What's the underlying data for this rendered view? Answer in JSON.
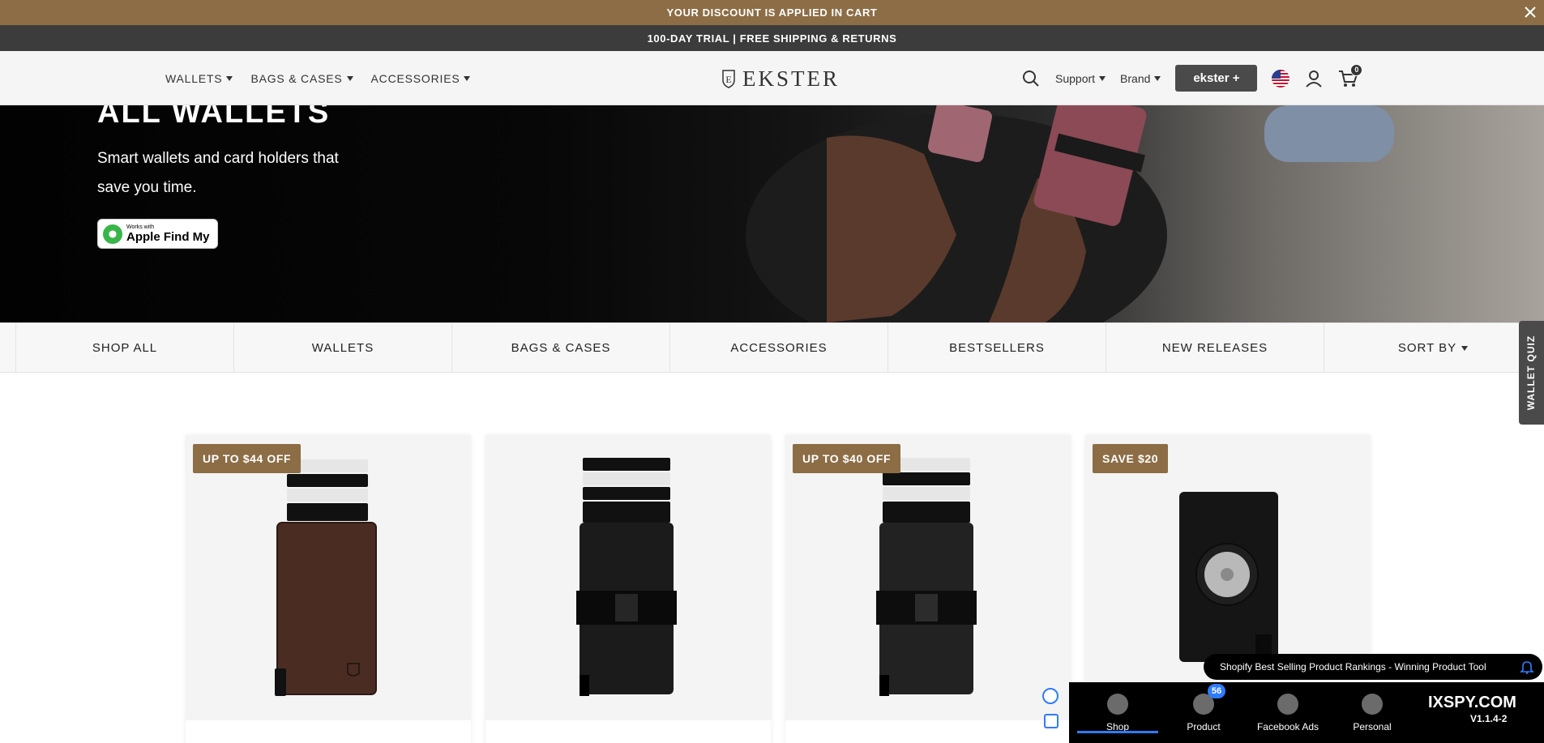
{
  "promo": {
    "discount_text": "YOUR DISCOUNT IS APPLIED IN CART",
    "trial_text": "100-DAY TRIAL | FREE SHIPPING & RETURNS"
  },
  "header": {
    "nav": [
      {
        "label": "WALLETS"
      },
      {
        "label": "BAGS & CASES"
      },
      {
        "label": "ACCESSORIES"
      }
    ],
    "logo_text": "EKSTER",
    "support_label": "Support",
    "brand_label": "Brand",
    "ekster_plus_label": "ekster +",
    "cart_count": "0"
  },
  "hero": {
    "title": "ALL WALLETS",
    "subtitle": "Smart wallets and card holders that save you time.",
    "findmy_small": "Works with",
    "findmy_big": "Apple Find My"
  },
  "categories": [
    {
      "label": "SHOP ALL"
    },
    {
      "label": "WALLETS"
    },
    {
      "label": "BAGS & CASES"
    },
    {
      "label": "ACCESSORIES"
    },
    {
      "label": "BESTSELLERS"
    },
    {
      "label": "NEW RELEASES"
    },
    {
      "label": "SORT BY"
    }
  ],
  "quiz_label": "WALLET QUIZ",
  "products": [
    {
      "badge": "UP TO $44 OFF"
    },
    {
      "badge": ""
    },
    {
      "badge": "UP TO $40 OFF"
    },
    {
      "badge": "SAVE $20"
    }
  ],
  "ixspy": {
    "banner_text": "Shopify Best Selling Product Rankings - Winning Product Tool",
    "tabs": [
      {
        "label": "Shop"
      },
      {
        "label": "Product",
        "badge": "56"
      },
      {
        "label": "Facebook Ads"
      },
      {
        "label": "Personal"
      }
    ],
    "brand": "IXSPY.COM",
    "version": "V1.1.4-2"
  },
  "colors": {
    "accent_brown": "#8c6d45",
    "dark_bar": "#3c3c3c",
    "ixspy_blue": "#2f7bff"
  }
}
